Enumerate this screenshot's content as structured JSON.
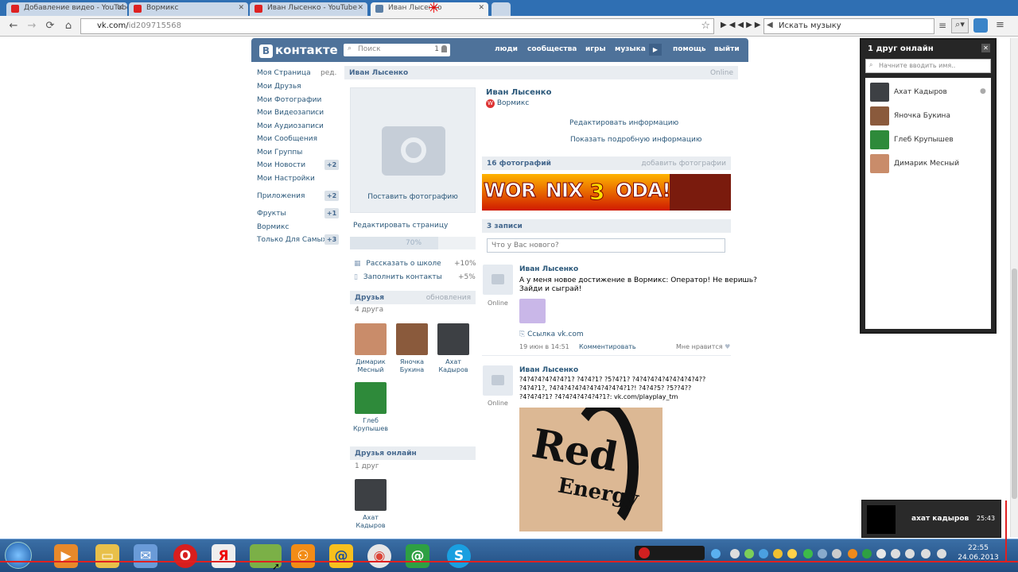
{
  "browser": {
    "tabs": [
      {
        "label": "Добавление видео - YouTube"
      },
      {
        "label": "Вормикс"
      },
      {
        "label": "Иван Лысенко - YouTube"
      },
      {
        "label": "Иван Лысенко"
      }
    ],
    "url_host": "vk.com/",
    "url_path": "id209715568",
    "music_search": "Искать музыку"
  },
  "vk": {
    "logo": "контакте",
    "logo_letter": "B",
    "search_placeholder": "Поиск",
    "search_count": "1",
    "nav": [
      "люди",
      "сообщества",
      "игры",
      "музыка",
      "помощь",
      "выйти"
    ],
    "menu": [
      {
        "label": "Моя Страница",
        "extra": "ред."
      },
      {
        "label": "Мои Друзья"
      },
      {
        "label": "Мои Фотографии"
      },
      {
        "label": "Мои Видеозаписи"
      },
      {
        "label": "Мои Аудиозаписи"
      },
      {
        "label": "Мои Сообщения"
      },
      {
        "label": "Мои Группы"
      },
      {
        "label": "Мои Новости",
        "badge": "+2"
      },
      {
        "label": "Мои Настройки"
      },
      {
        "label": "Приложения",
        "badge": "+2"
      },
      {
        "label": "Фрукты",
        "badge": "+1"
      },
      {
        "label": "Вормикс"
      },
      {
        "label": "Только Для Самых",
        "badge": "+3"
      }
    ],
    "profile": {
      "name_bar": "Иван Лысенко",
      "status": "Online",
      "add_photo": "Поставить фотографию",
      "edit_page": "Редактировать страницу",
      "progress_label": "70%",
      "progress_value": 0.7,
      "tasks": [
        {
          "label": "Рассказать о школе",
          "pct": "+10%"
        },
        {
          "label": "Заполнить контакты",
          "pct": "+5%"
        }
      ],
      "friends_title": "Друзья",
      "friends_updates": "обновления",
      "friends_count": "4 друга",
      "friends": [
        {
          "first": "Димарик",
          "last": "Месный"
        },
        {
          "first": "Яночка",
          "last": "Букина"
        },
        {
          "first": "Ахат",
          "last": "Кадыров"
        },
        {
          "first": "Глеб",
          "last": "Крупышев"
        }
      ],
      "online_title": "Друзья онлайн",
      "online_count": "1 друг",
      "online_friend": {
        "first": "Ахат",
        "last": "Кадыров"
      },
      "title_name": "Иван Лысенко",
      "app_name": "Вормикс",
      "edit_info": "Редактировать информацию",
      "more_info": "Показать подробную информацию",
      "photos_title": "16 фотографий",
      "photos_add": "добавить фотографии",
      "banner": [
        "WOR",
        "NIX",
        "3",
        "ODA!!!"
      ],
      "wall_title": "3 записи",
      "wall_placeholder": "Что у Вас нового?"
    },
    "posts": [
      {
        "author": "Иван Лысенко",
        "status": "Online",
        "text1": "А у меня новое достижение в Вормикс: Оператор! Не веришь?",
        "text2": "Зайди и сыграй!",
        "link": "Ссылка vk.com",
        "date": "19 июн в 14:51",
        "comment": "Комментировать",
        "like": "Мне нравится"
      },
      {
        "author": "Иван Лысенко",
        "status": "Online",
        "text1": "?4?4?4?4?4?4?1? ?4?4?1? ?5?4?1? ?4?4?4?4?4?4?4?4?4??",
        "text2": "?4?4?1?, ?4?4?4?4?4?4?4?4?4?4?1?! ?4?4?5? ?5??4??",
        "text3": "?4?4?4?1? ?4?4?4?4?4?4?1?: vk.com/playplay_tm",
        "image_word1": "Red",
        "image_word2": "Energy"
      }
    ]
  },
  "right_panel": {
    "title": "1 друг онлайн",
    "search_placeholder": "Начните вводить имя..",
    "friends": [
      "Ахат Кадыров",
      "Яночка Букина",
      "Глеб Крупышев",
      "Димарик Месный"
    ]
  },
  "notification": {
    "name": "ахат кадыров",
    "time": "25:43"
  },
  "taskbar": {
    "time": "22:55",
    "date": "24.06.2013"
  }
}
